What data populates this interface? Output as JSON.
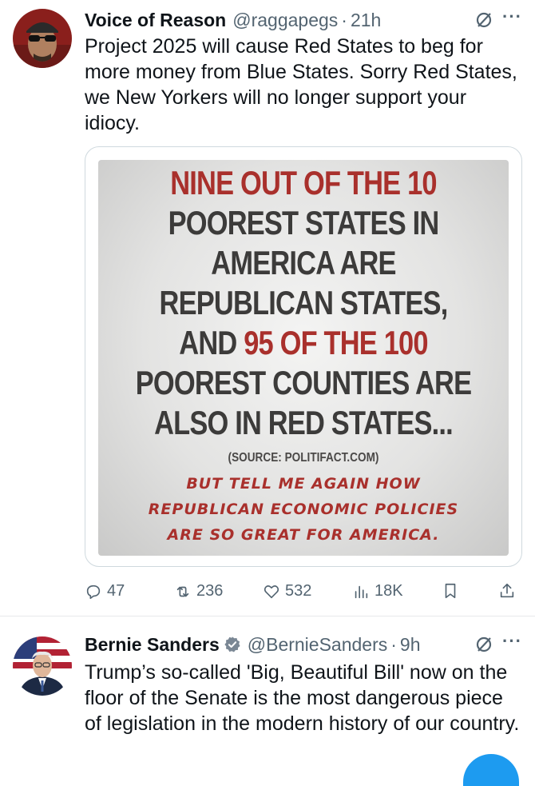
{
  "tweets": [
    {
      "author": "Voice of Reason",
      "handle": "@raggapegs",
      "sep": "·",
      "time": "21h",
      "more": "···",
      "text": "Project 2025 will cause Red States to beg for more money from Blue States. Sorry Red States, we New Yorkers will no longer support your idiocy.",
      "media": {
        "lines": [
          {
            "parts": [
              {
                "t": "NINE OUT OF THE 10",
                "red": true
              }
            ]
          },
          {
            "parts": [
              {
                "t": "POOREST STATES IN",
                "red": false
              }
            ]
          },
          {
            "parts": [
              {
                "t": "AMERICA ARE",
                "red": false
              }
            ]
          },
          {
            "parts": [
              {
                "t": "REPUBLICAN STATES,",
                "red": false
              }
            ]
          },
          {
            "parts": [
              {
                "t": "AND ",
                "red": false
              },
              {
                "t": "95 OF THE 100",
                "red": true
              }
            ]
          },
          {
            "parts": [
              {
                "t": "POOREST COUNTIES ARE",
                "red": false
              }
            ]
          },
          {
            "parts": [
              {
                "t": "ALSO IN RED STATES...",
                "red": false
              }
            ]
          }
        ],
        "source": "(SOURCE: POLITIFACT.COM)",
        "handwritten": [
          "BUT TELL ME AGAIN HOW",
          "REPUBLICAN ECONOMIC POLICIES",
          "ARE SO GREAT FOR AMERICA."
        ]
      },
      "actions": {
        "replies": "47",
        "reposts": "236",
        "likes": "532",
        "views": "18K"
      }
    },
    {
      "author": "Bernie Sanders",
      "handle": "@BernieSanders",
      "sep": "·",
      "time": "9h",
      "more": "···",
      "verified": true,
      "text": "Trump’s so-called 'Big, Beautiful Bill' now on the floor of the Senate is the most dangerous piece of legislation in the modern history of our country."
    }
  ],
  "colors": {
    "accent": "#1d9bf0",
    "secondary_text": "#536471",
    "poster_red": "#a9302c"
  }
}
